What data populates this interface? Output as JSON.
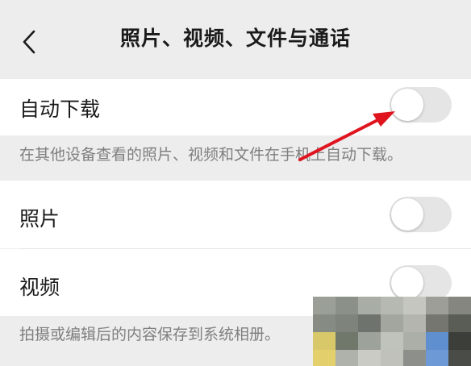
{
  "nav": {
    "title": "照片、视频、文件与通话",
    "back_icon": "chevron-left-icon"
  },
  "auto_download": {
    "label": "自动下载",
    "enabled": false,
    "hint": "在其他设备查看的照片、视频和文件在手机上自动下载。"
  },
  "photos": {
    "label": "照片",
    "enabled": false
  },
  "videos": {
    "label": "视频",
    "enabled": false
  },
  "save_hint": "拍摄或编辑后的内容保存到系统相册。",
  "colors": {
    "background": "#ededed",
    "cell": "#ffffff",
    "toggle_off": "#e5e5e5",
    "hint_text": "#7f7f7f",
    "annotation_arrow": "#e0141e"
  }
}
